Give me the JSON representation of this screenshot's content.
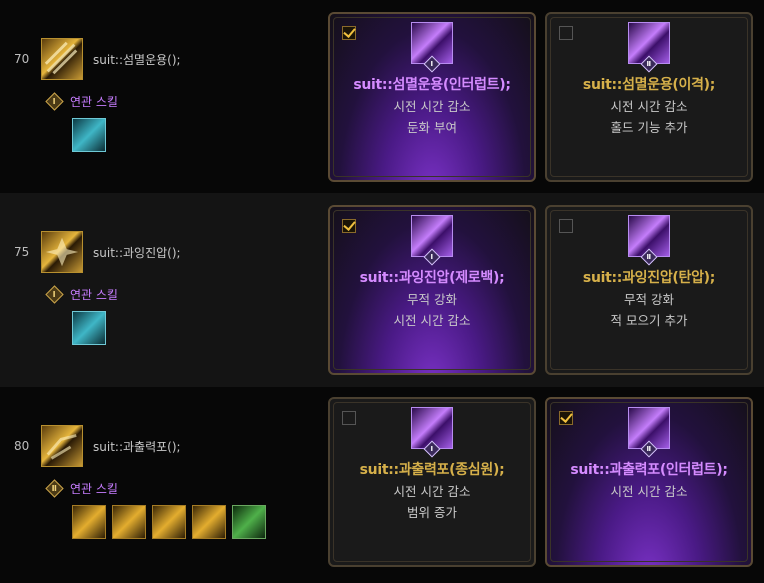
{
  "rows": [
    {
      "level": "70",
      "skill_name": "suit::섬멸운용();",
      "related_label": "연관 스킬",
      "related_badge": "Ⅰ",
      "related_icon_count": 1,
      "options": [
        {
          "selected": true,
          "badge": "Ⅰ",
          "title": "suit::섬멸운용(인터럽트);",
          "desc": [
            "시전 시간 감소",
            "둔화 부여"
          ]
        },
        {
          "selected": false,
          "badge": "Ⅱ",
          "title": "suit::섬멸운용(이격);",
          "desc": [
            "시전 시간 감소",
            "홀드 기능 추가"
          ]
        }
      ]
    },
    {
      "level": "75",
      "skill_name": "suit::과잉진압();",
      "related_label": "연관 스킬",
      "related_badge": "Ⅰ",
      "related_icon_count": 1,
      "options": [
        {
          "selected": true,
          "badge": "Ⅰ",
          "title": "suit::과잉진압(제로백);",
          "desc": [
            "무적 강화",
            "시전 시간 감소"
          ]
        },
        {
          "selected": false,
          "badge": "Ⅱ",
          "title": "suit::과잉진압(탄압);",
          "desc": [
            "무적 강화",
            "적 모으기 추가"
          ]
        }
      ]
    },
    {
      "level": "80",
      "skill_name": "suit::과출력포();",
      "related_label": "연관 스킬",
      "related_badge": "Ⅱ",
      "related_icon_count": 5,
      "options": [
        {
          "selected": false,
          "badge": "Ⅰ",
          "title": "suit::과출력포(종심원);",
          "desc": [
            "시전 시간 감소",
            "범위 증가"
          ]
        },
        {
          "selected": true,
          "badge": "Ⅱ",
          "title": "suit::과출력포(인터럽트);",
          "desc": [
            "시전 시간 감소"
          ]
        }
      ]
    }
  ]
}
